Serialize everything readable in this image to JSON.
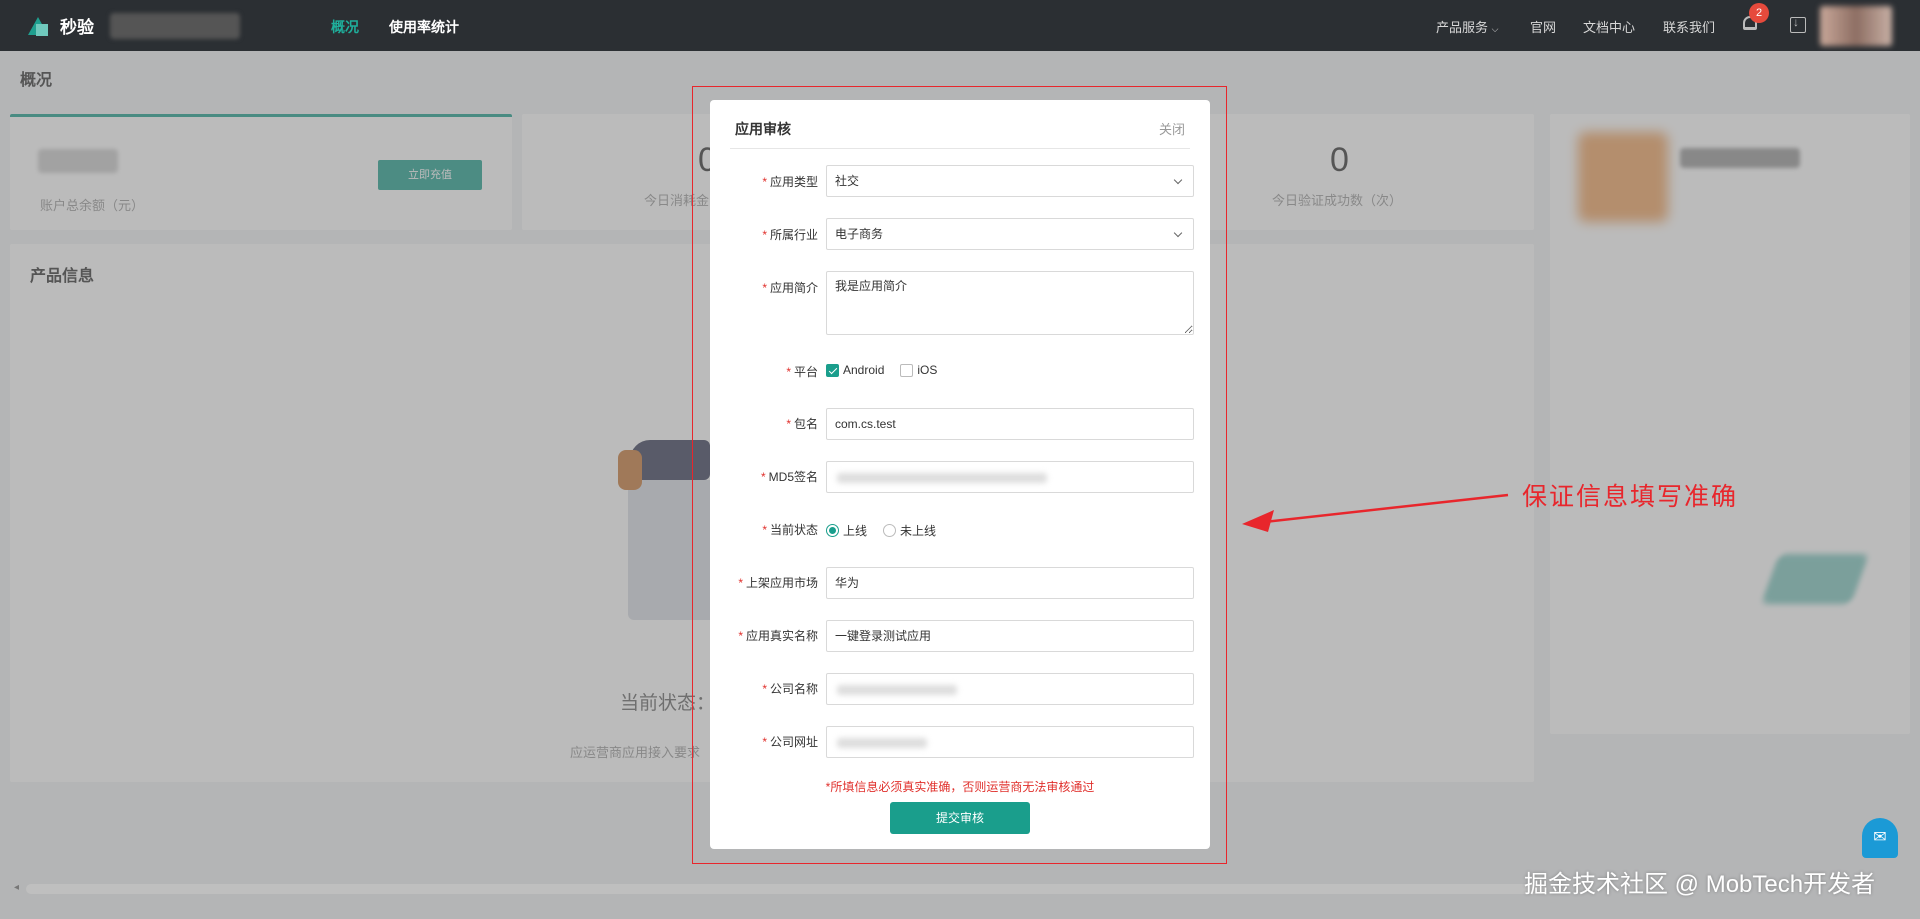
{
  "topnav": {
    "logo_text": "秒验",
    "tabs": [
      "概况",
      "使用率统计"
    ],
    "right_links": [
      "产品服务",
      "官网",
      "文档中心",
      "联系我们"
    ],
    "notification_count": "2"
  },
  "page": {
    "title": "概况",
    "balance_label": "账户总余额（元）",
    "recharge_label": "立即充值",
    "stat_mid_num": "0",
    "stat_mid_label": "今日消耗金",
    "stat_right_num": "0",
    "stat_right_label": "今日验证成功数（次）",
    "section_title": "产品信息",
    "status_text": "当前状态：",
    "status_sub": "应运营商应用接入要求"
  },
  "modal": {
    "title": "应用审核",
    "close_label": "关闭",
    "fields": {
      "app_type": {
        "label": "应用类型",
        "value": "社交"
      },
      "industry": {
        "label": "所属行业",
        "value": "电子商务"
      },
      "intro": {
        "label": "应用简介",
        "value": "我是应用简介"
      },
      "platform": {
        "label": "平台",
        "options": [
          "Android",
          "iOS"
        ]
      },
      "package": {
        "label": "包名",
        "value": "com.cs.test"
      },
      "md5": {
        "label": "MD5签名"
      },
      "status": {
        "label": "当前状态",
        "options": [
          "上线",
          "未上线"
        ]
      },
      "market": {
        "label": "上架应用市场",
        "value": "华为"
      },
      "real_name": {
        "label": "应用真实名称",
        "value": "一键登录测试应用"
      },
      "company": {
        "label": "公司名称"
      },
      "website": {
        "label": "公司网址"
      }
    },
    "warning": "*所填信息必须真实准确，否则运营商无法审核通过",
    "submit_label": "提交审核"
  },
  "annotation": {
    "text": "保证信息填写准确",
    "color": "#e8262c"
  },
  "watermark": "掘金技术社区 @ MobTech开发者",
  "colors": {
    "accent": "#1a9e8c",
    "nav_bg": "#2b2f33",
    "required": "#e0302c"
  }
}
